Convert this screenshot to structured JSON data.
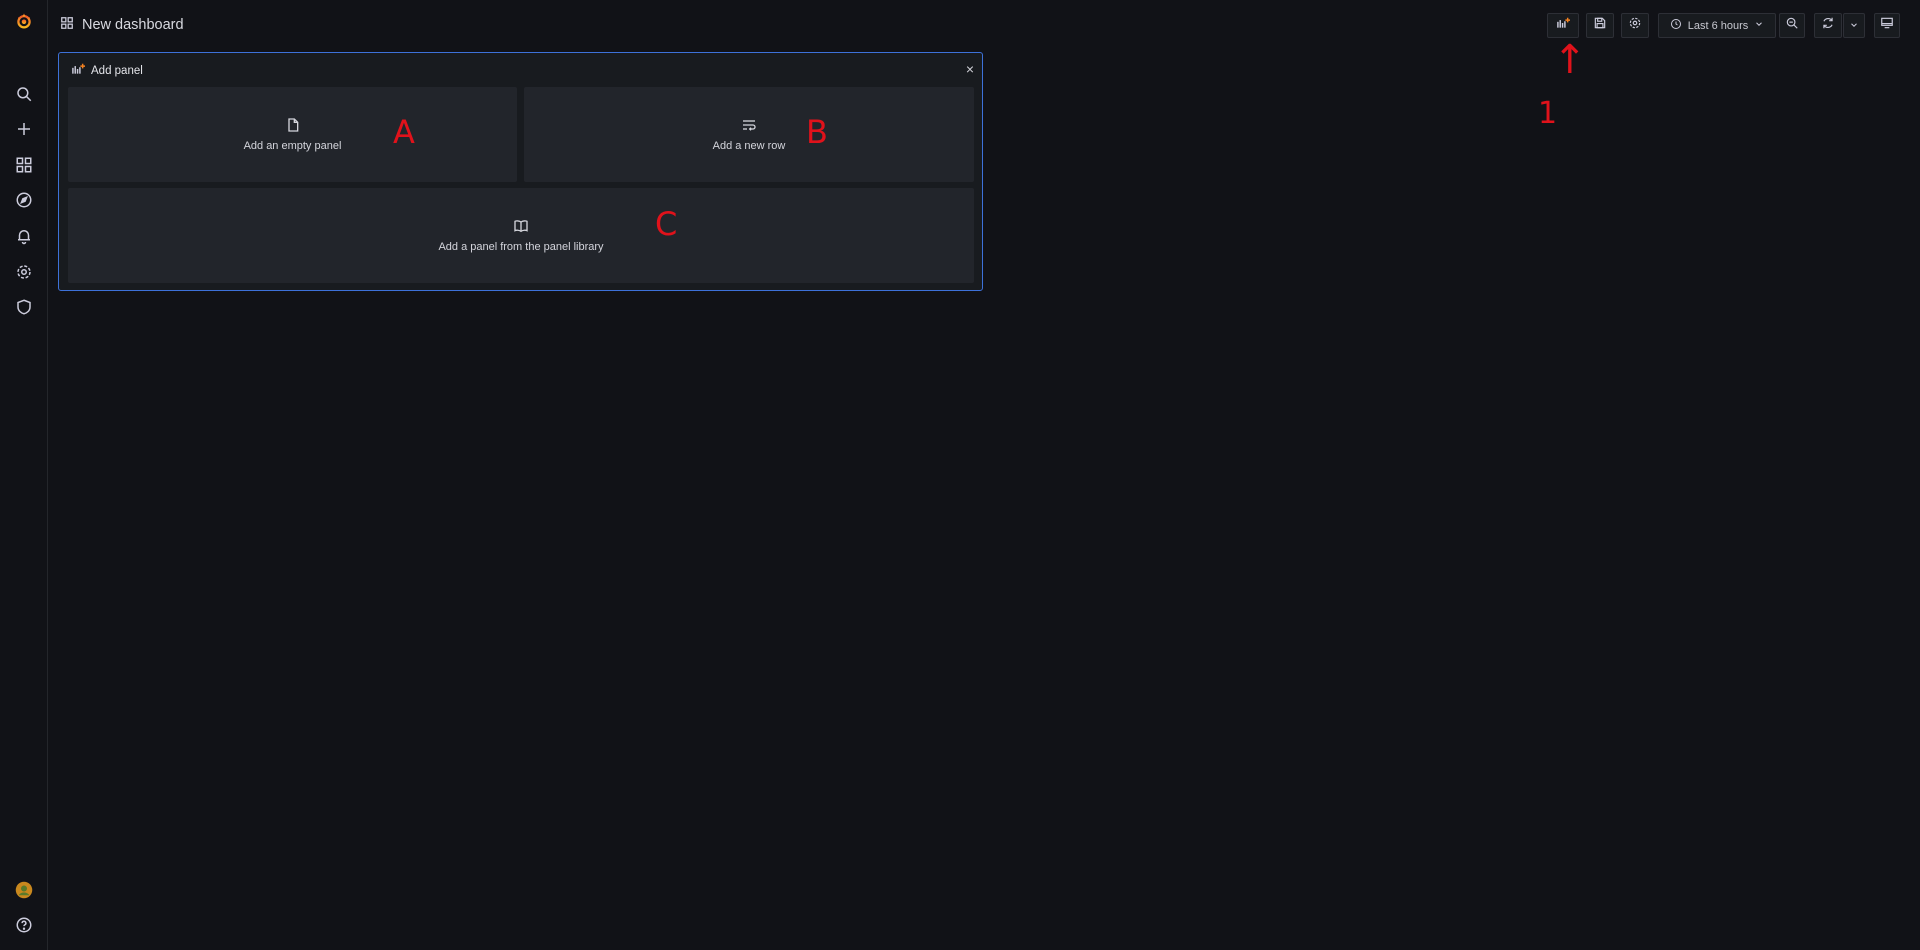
{
  "sidebar": {
    "items": [
      {
        "icon": "grafana-logo-icon"
      },
      {
        "icon": "search-icon"
      },
      {
        "icon": "plus-icon"
      },
      {
        "icon": "dashboards-icon"
      },
      {
        "icon": "explore-compass-icon"
      },
      {
        "icon": "bell-icon"
      },
      {
        "icon": "gear-icon"
      },
      {
        "icon": "shield-icon"
      },
      {
        "icon": "user-avatar-icon"
      },
      {
        "icon": "help-icon"
      }
    ]
  },
  "header": {
    "title": "New dashboard",
    "time_range": "Last 6 hours"
  },
  "add_panel": {
    "title": "Add panel",
    "close": "×",
    "options": [
      {
        "label": "Add an empty panel",
        "icon": "file-icon"
      },
      {
        "label": "Add a new row",
        "icon": "row-icon"
      },
      {
        "label": "Add a panel from the panel library",
        "icon": "book-icon"
      }
    ]
  },
  "annotations": {
    "a": "A",
    "b": "B",
    "c": "C",
    "one": "1",
    "arrow": "↑"
  },
  "colors": {
    "accent_blue": "#3d71d9",
    "annotation_red": "#e0121b",
    "grafana_orange": "#f58220"
  }
}
